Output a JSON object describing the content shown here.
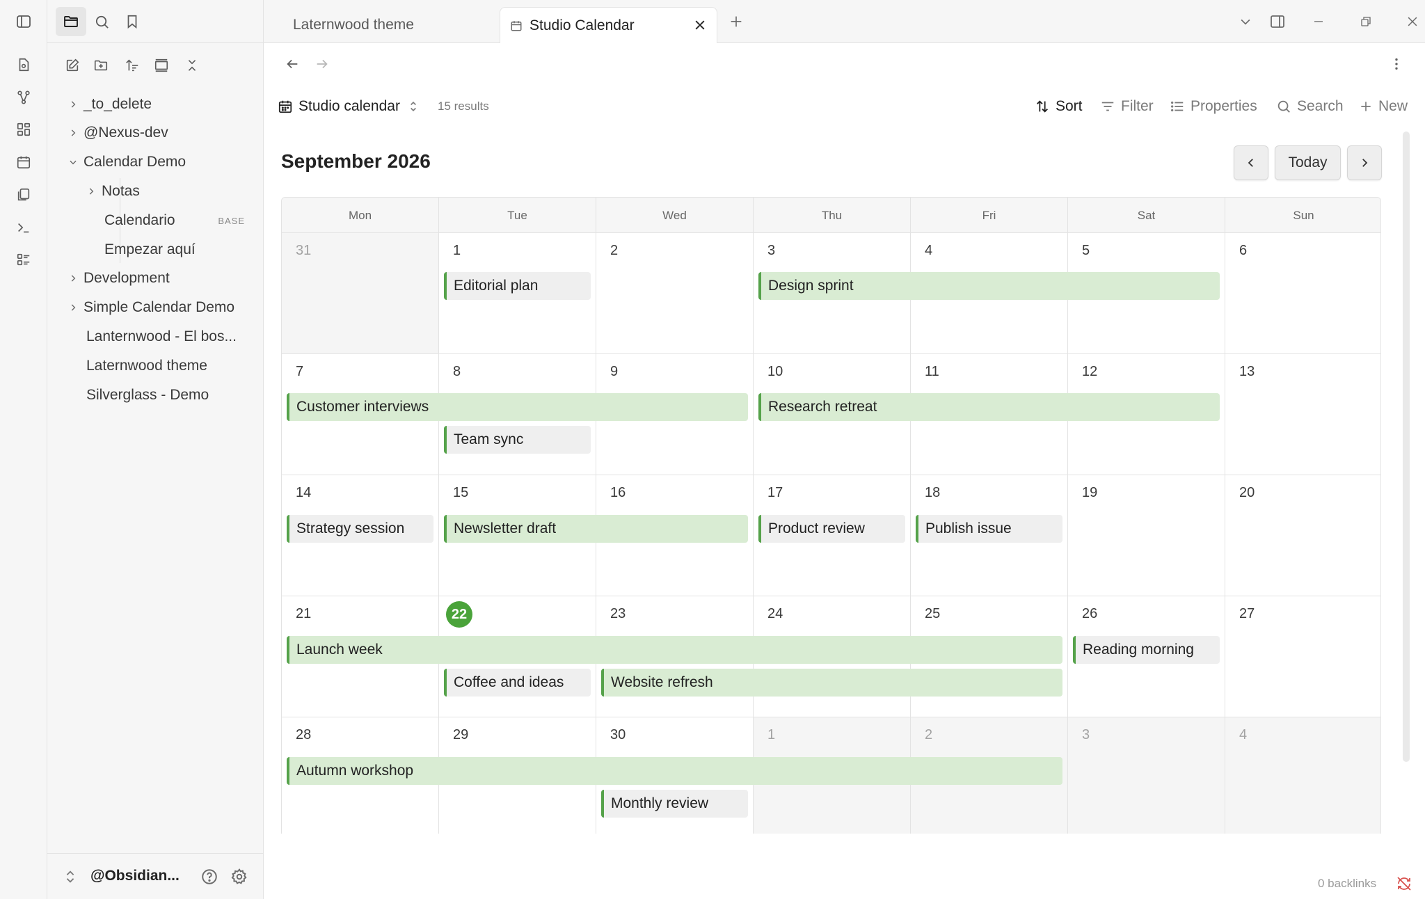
{
  "sidebar": {
    "tree": [
      {
        "label": "_to_delete",
        "type": "folder",
        "expanded": false
      },
      {
        "label": "@Nexus-dev",
        "type": "folder",
        "expanded": false
      },
      {
        "label": "Calendar Demo",
        "type": "folder",
        "expanded": true
      },
      {
        "label": "Notas",
        "type": "folder",
        "expanded": false
      },
      {
        "label": "Calendario",
        "type": "file",
        "badge": "BASE"
      },
      {
        "label": "Empezar aquí",
        "type": "file"
      },
      {
        "label": "Development",
        "type": "folder",
        "expanded": false
      },
      {
        "label": "Simple Calendar Demo",
        "type": "folder",
        "expanded": false
      },
      {
        "label": "Lanternwood - El bos...",
        "type": "file"
      },
      {
        "label": "Laternwood theme",
        "type": "file"
      },
      {
        "label": "Silverglass - Demo",
        "type": "file"
      }
    ],
    "vault_name": "@Obsidian..."
  },
  "tabs": [
    {
      "label": "Laternwood theme",
      "active": false
    },
    {
      "label": "Studio Calendar",
      "active": true
    }
  ],
  "toolbar": {
    "view_name": "Studio calendar",
    "results": "15 results",
    "sort": "Sort",
    "filter": "Filter",
    "properties": "Properties",
    "search": "Search",
    "new": "New"
  },
  "calendar": {
    "month_title": "September 2026",
    "today_button": "Today",
    "weekdays": [
      "Mon",
      "Tue",
      "Wed",
      "Thu",
      "Fri",
      "Sat",
      "Sun"
    ],
    "weeks": [
      [
        "31",
        "1",
        "2",
        "3",
        "4",
        "5",
        "6"
      ],
      [
        "7",
        "8",
        "9",
        "10",
        "11",
        "12",
        "13"
      ],
      [
        "14",
        "15",
        "16",
        "17",
        "18",
        "19",
        "20"
      ],
      [
        "21",
        "22",
        "23",
        "24",
        "25",
        "26",
        "27"
      ],
      [
        "28",
        "29",
        "30",
        "1",
        "2",
        "3",
        "4"
      ]
    ],
    "today": "22",
    "events": [
      {
        "title": "Editorial plan",
        "start": "Sep 1",
        "end": "Sep 1"
      },
      {
        "title": "Design sprint",
        "start": "Sep 3",
        "end": "Sep 5"
      },
      {
        "title": "Customer interviews",
        "start": "Sep 7",
        "end": "Sep 9"
      },
      {
        "title": "Research retreat",
        "start": "Sep 10",
        "end": "Sep 12"
      },
      {
        "title": "Team sync",
        "start": "Sep 8",
        "end": "Sep 8"
      },
      {
        "title": "Strategy session",
        "start": "Sep 14",
        "end": "Sep 14"
      },
      {
        "title": "Newsletter draft",
        "start": "Sep 15",
        "end": "Sep 16"
      },
      {
        "title": "Product review",
        "start": "Sep 17",
        "end": "Sep 17"
      },
      {
        "title": "Publish issue",
        "start": "Sep 18",
        "end": "Sep 18"
      },
      {
        "title": "Launch week",
        "start": "Sep 21",
        "end": "Sep 25"
      },
      {
        "title": "Reading morning",
        "start": "Sep 26",
        "end": "Sep 26"
      },
      {
        "title": "Coffee and ideas",
        "start": "Sep 22",
        "end": "Sep 22"
      },
      {
        "title": "Website refresh",
        "start": "Sep 23",
        "end": "Sep 25"
      },
      {
        "title": "Autumn workshop",
        "start": "Sep 28",
        "end": "Oct 2"
      },
      {
        "title": "Monthly review",
        "start": "Sep 30",
        "end": "Sep 30"
      }
    ]
  },
  "footer": {
    "backlinks": "0 backlinks"
  },
  "colors": {
    "accent": "#4aa33a",
    "event_span_bg": "#d9ecd3",
    "event_single_bg": "#efefef",
    "event_border": "#55a24a"
  }
}
